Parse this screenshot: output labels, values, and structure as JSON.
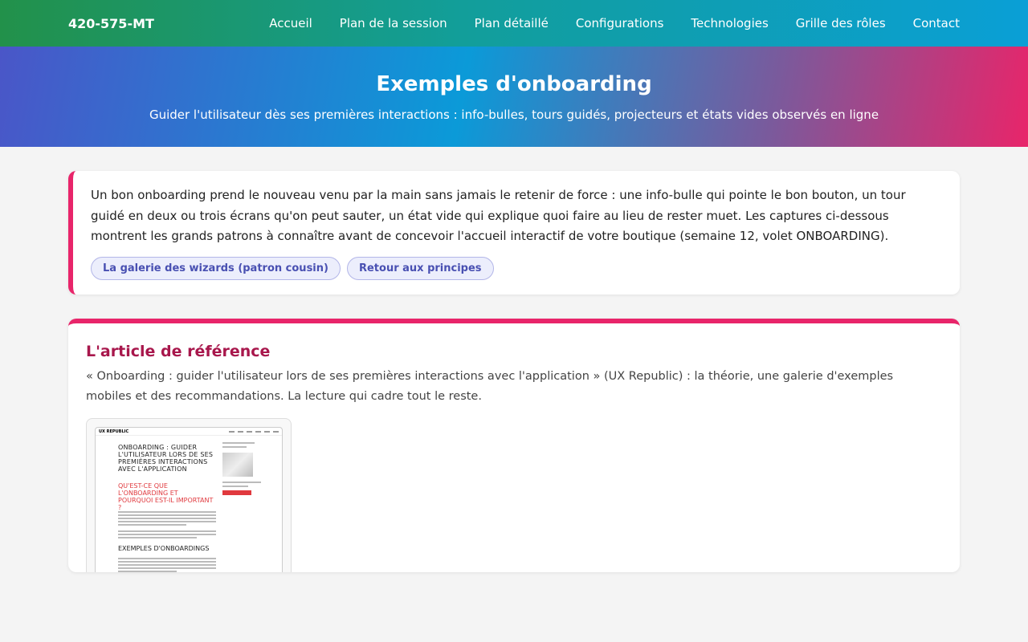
{
  "nav": {
    "brand": "420-575-MT",
    "links": [
      "Accueil",
      "Plan de la session",
      "Plan détaillé",
      "Configurations",
      "Technologies",
      "Grille des rôles",
      "Contact"
    ]
  },
  "hero": {
    "title": "Exemples d'onboarding",
    "subtitle": "Guider l'utilisateur dès ses premières interactions : info-bulles, tours guidés, projecteurs et états vides observés en ligne"
  },
  "intro": {
    "text": "Un bon onboarding prend le nouveau venu par la main sans jamais le retenir de force : une info-bulle qui pointe le bon bouton, un tour guidé en deux ou trois écrans qu'on peut sauter, un état vide qui explique quoi faire au lieu de rester muet. Les captures ci-dessous montrent les grands patrons à connaître avant de concevoir l'accueil interactif de votre boutique (semaine 12, volet ONBOARDING).",
    "pills": [
      "La galerie des wizards (patron cousin)",
      "Retour aux principes"
    ]
  },
  "article": {
    "heading": "L'article de référence",
    "description": "« Onboarding : guider l'utilisateur lors de ses premières interactions avec l'application » (UX Republic) : la théorie, une galerie d'exemples mobiles et des recommandations. La lecture qui cadre tout le reste.",
    "thumbnail": {
      "logo": "UX REPUBLIC",
      "title": "ONBOARDING : GUIDER L'UTILISATEUR LORS DE SES PREMIÈRES INTERACTIONS AVEC L'APPLICATION",
      "red_heading": "QU'EST-CE QUE L'ONBOARDING ET POURQUOI EST-IL IMPORTANT ?",
      "sub_heading": "EXEMPLES D'ONBOARDINGS"
    }
  },
  "colors": {
    "accent": "#e8256a",
    "heading": "#a8174c",
    "pill_text": "#4950b2"
  }
}
